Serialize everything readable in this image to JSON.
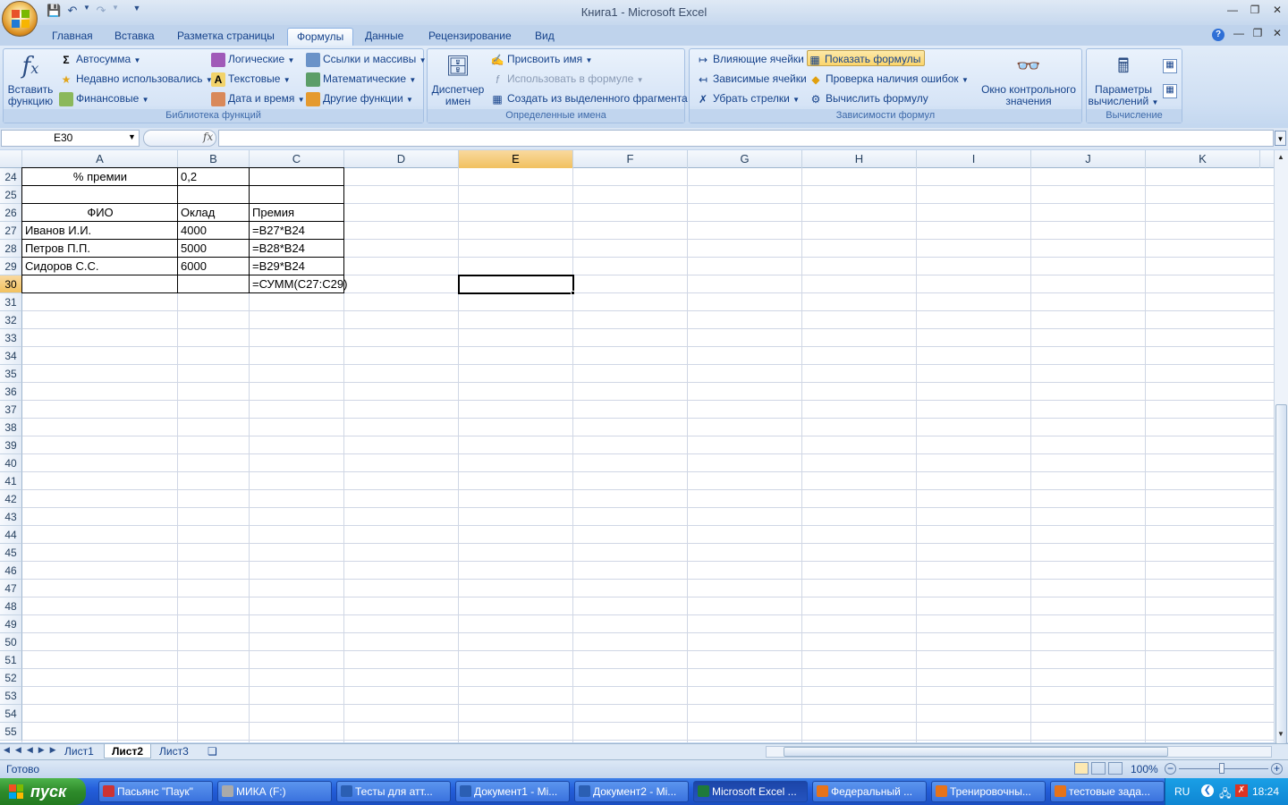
{
  "window": {
    "title": "Книга1 - Microsoft Excel"
  },
  "tabs": [
    "Главная",
    "Вставка",
    "Разметка страницы",
    "Формулы",
    "Данные",
    "Рецензирование",
    "Вид"
  ],
  "active_tab": "Формулы",
  "ribbon": {
    "insert_function": [
      "Вставить",
      "функцию"
    ],
    "lib": {
      "autosum": "Автосумма",
      "recent": "Недавно использовались",
      "financial": "Финансовые",
      "logical": "Логические",
      "text": "Текстовые",
      "datetime": "Дата и время",
      "lookup": "Ссылки и массивы",
      "math": "Математические",
      "other": "Другие функции",
      "label": "Библиотека функций"
    },
    "names": {
      "manager": [
        "Диспетчер",
        "имен"
      ],
      "define": "Присвоить имя",
      "use": "Использовать в формуле",
      "create": "Создать из выделенного фрагмента",
      "label": "Определенные имена"
    },
    "audit": {
      "precedents": "Влияющие ячейки",
      "dependents": "Зависимые ячейки",
      "remove": "Убрать стрелки",
      "show": "Показать формулы",
      "check": "Проверка наличия ошибок",
      "evaluate": "Вычислить формулу",
      "watch": [
        "Окно контрольного",
        "значения"
      ],
      "label": "Зависимости формул"
    },
    "calc": {
      "options": [
        "Параметры",
        "вычислений"
      ],
      "label": "Вычисление"
    }
  },
  "namebox": "E30",
  "fx": "fx",
  "columns": [
    "A",
    "B",
    "C",
    "D",
    "E",
    "F",
    "G",
    "H",
    "I",
    "J",
    "K"
  ],
  "selected_col": "E",
  "rows": [
    "24",
    "25",
    "26",
    "27",
    "28",
    "29",
    "30",
    "31",
    "32",
    "33",
    "34",
    "35",
    "36",
    "37",
    "38",
    "39",
    "40",
    "41",
    "42",
    "43",
    "44",
    "45",
    "46",
    "47",
    "48",
    "49",
    "50",
    "51",
    "52",
    "53",
    "54",
    "55"
  ],
  "selected_row": "30",
  "cells": {
    "A24": "% премии",
    "B24": "0,2",
    "A26": "ФИО",
    "B26": "Оклад",
    "C26": "Премия",
    "A27": "Иванов И.И.",
    "B27": "4000",
    "C27": "=B27*B24",
    "A28": "Петров П.П.",
    "B28": "5000",
    "C28": "=B28*B24",
    "A29": "Сидоров С.С.",
    "B29": "6000",
    "C29": "=B29*B24",
    "C30": "=СУММ(C27:C29)"
  },
  "sheets": [
    "Лист1",
    "Лист2",
    "Лист3"
  ],
  "active_sheet": "Лист2",
  "status": {
    "ready": "Готово",
    "zoom": "100%"
  },
  "taskbar": {
    "start": "пуск",
    "items": [
      "Пасьянс \"Паук\"",
      "МИКА (F:)",
      "Тесты для атт...",
      "Документ1 - Mi...",
      "Документ2 - Mi...",
      "Microsoft Excel ...",
      "Федеральный ...",
      "Тренировочны...",
      "тестовые зада..."
    ],
    "active": "Microsoft Excel ...",
    "lang": "RU",
    "time": "18:24"
  }
}
